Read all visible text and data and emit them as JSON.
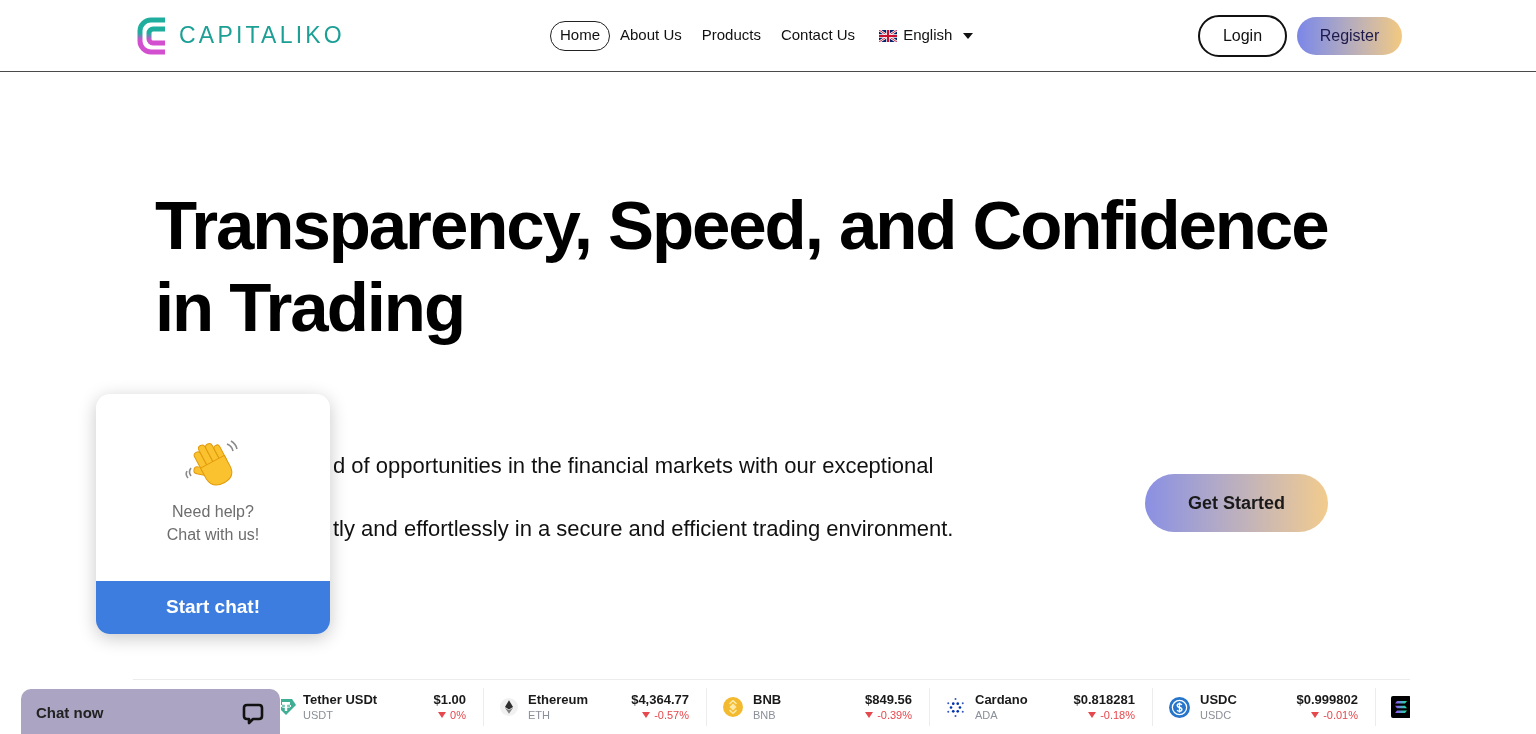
{
  "header": {
    "logo": {
      "text": "CAPITALIKO"
    },
    "nav": [
      {
        "label": "Home",
        "selected": true
      },
      {
        "label": "About Us",
        "selected": false
      },
      {
        "label": "Products",
        "selected": false
      },
      {
        "label": "Contact Us",
        "selected": false
      }
    ],
    "language": {
      "label": "English"
    },
    "buttons": [
      {
        "label": "Login",
        "kind": "outline"
      },
      {
        "label": "Register",
        "kind": "gradient"
      }
    ]
  },
  "hero": {
    "title": "Transparency, Speed, and Confidence in Trading",
    "description_lines": [
      "d of opportunities in the financial markets with our exceptional",
      "tly and effortlessly in a secure and efficient trading environment."
    ],
    "cta": {
      "label": "Get Started"
    }
  },
  "ticker": [
    {
      "name": "Tether USDt",
      "symbol": "USDT",
      "price": "$1.00",
      "change": "0%",
      "falling": true
    },
    {
      "name": "Ethereum",
      "symbol": "ETH",
      "price": "$4,364.77",
      "change": "-0.57%",
      "falling": true
    },
    {
      "name": "BNB",
      "symbol": "BNB",
      "price": "$849.56",
      "change": "-0.39%",
      "falling": true
    },
    {
      "name": "Cardano",
      "symbol": "ADA",
      "price": "$0.818281",
      "change": "-0.18%",
      "falling": true
    },
    {
      "name": "USDC",
      "symbol": "USDC",
      "price": "$0.999802",
      "change": "-0.01%",
      "falling": true
    }
  ],
  "chat_popup": {
    "lines": [
      "Need help?",
      "Chat with us!"
    ],
    "button": {
      "label": "Start chat!"
    }
  },
  "chat_bar": {
    "label": "Chat now"
  }
}
